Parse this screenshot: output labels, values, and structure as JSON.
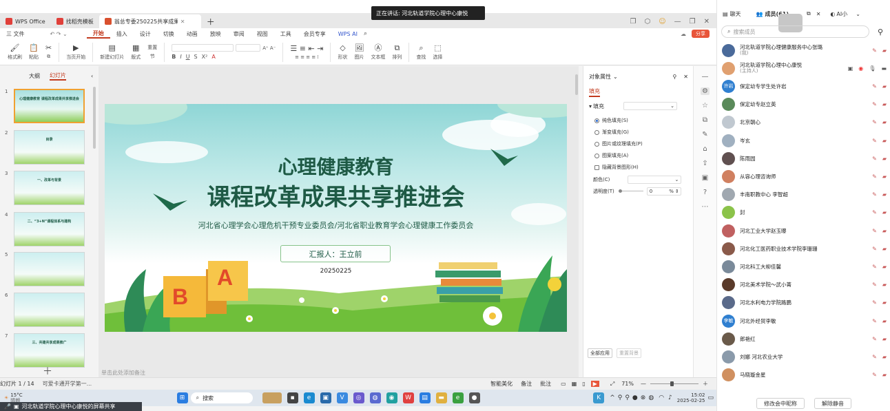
{
  "speaking_banner": "正在讲话: 河北轨道学院心理中心康悦",
  "tabs": [
    {
      "label": "WPS Office",
      "color": "#e0403a"
    },
    {
      "label": "找稻壳模板",
      "color": "#e0403a"
    },
    {
      "label": "翁总专委250225共享成果.pp",
      "color": "#d9502e"
    }
  ],
  "menu": [
    "三 文件",
    "开始",
    "插入",
    "设计",
    "切换",
    "动画",
    "放映",
    "审阅",
    "视图",
    "工具",
    "会员专享",
    "WPS AI"
  ],
  "share_button": "分享",
  "ribbon": {
    "format_painter": "格式刷",
    "paste": "粘贴",
    "from_current": "当页开始",
    "new_slide": "新建幻灯片",
    "layout": "版式",
    "section": "节",
    "reset": "重置",
    "shape": "形状",
    "picture": "图片",
    "textbox": "文本框",
    "arrange": "排列",
    "find": "查找",
    "select": "选择"
  },
  "thumb_tabs": {
    "outline": "大纲",
    "slides": "幻灯片"
  },
  "thumbs": [
    {
      "num": "1",
      "title": "心理健康教育 课程改革成果共享推进会"
    },
    {
      "num": "2",
      "title": "目录"
    },
    {
      "num": "3",
      "title": "一、改革与背景"
    },
    {
      "num": "4",
      "title": "二、“3+N”课程体系与建构"
    },
    {
      "num": "5",
      "title": ""
    },
    {
      "num": "6",
      "title": ""
    },
    {
      "num": "7",
      "title": "三、共建共享成果推广"
    }
  ],
  "slide": {
    "title1": "心理健康教育",
    "title2": "课程改革成果共享推进会",
    "subtitle": "河北省心理学会心理危机干预专业委员会/河北省职业教育学会心理健康工作委员会",
    "reporter": "汇报人：王立前",
    "date": "20250225",
    "letters": [
      "B",
      "A"
    ]
  },
  "notes_placeholder": "单击此处添加备注",
  "props": {
    "title": "对象属性",
    "tab": "填充",
    "fill_label": "填充",
    "options": [
      "纯色填充(S)",
      "渐变填充(G)",
      "图片或纹理填充(P)",
      "图案填充(A)",
      "隐藏背景图形(H)"
    ],
    "color_label": "颜色(C)",
    "transparency_label": "透明度(T)",
    "transparency_value": "0",
    "transparency_unit": "%",
    "transparency_fraction": 0,
    "apply_all": "全部应用",
    "reset_bg": "重置背景"
  },
  "status": {
    "slide_count": "幻灯片 1 / 14",
    "theme": "可爱卡通开学第一...",
    "smart_beautify": "智能美化",
    "notes": "备注",
    "comments": "批注",
    "zoom": "71%",
    "zoom_fraction": 0.44
  },
  "taskbar": {
    "weather_temp": "15°C",
    "weather_desc": "晴朗",
    "search": "搜索",
    "time": "15:02",
    "date": "2025-02-25"
  },
  "sharebar_text": "河北轨道学院心理中心康悦的屏幕共享",
  "meeting": {
    "tab_chat": "聊天",
    "tab_members": "成员(61)",
    "tab_ai": "AI小",
    "search_placeholder": "搜索成员",
    "members": [
      {
        "name": "河北轨道学院心理健康服务中心张璐",
        "role": "(我)",
        "color": "#4a6a9a",
        "initial": ""
      },
      {
        "name": "河北轨道学院心理中心康悦",
        "role": "(主持人)",
        "color": "#e0a070",
        "initial": ""
      },
      {
        "name": "保定幼专学生处许岩",
        "role": "",
        "color": "#2f7fd0",
        "initial": "许岩"
      },
      {
        "name": "保定幼专赵立英",
        "role": "",
        "color": "#5a8a5a",
        "initial": ""
      },
      {
        "name": "北京朝心",
        "role": "",
        "color": "#c0c8d0",
        "initial": ""
      },
      {
        "name": "岑玄",
        "role": "",
        "color": "#a0b0c0",
        "initial": ""
      },
      {
        "name": "陈雨园",
        "role": "",
        "color": "#605050",
        "initial": ""
      },
      {
        "name": "从容心理咨询师",
        "role": "",
        "color": "#d08060",
        "initial": ""
      },
      {
        "name": "丰南职教中心 李智超",
        "role": "",
        "color": "#a0a8b0",
        "initial": ""
      },
      {
        "name": "封",
        "role": "",
        "color": "#8bc34a",
        "initial": ""
      },
      {
        "name": "河北工业大学赵玉曝",
        "role": "",
        "color": "#c06060",
        "initial": ""
      },
      {
        "name": "河北化工医药职业技术学院李珊珊",
        "role": "",
        "color": "#8a5a4a",
        "initial": ""
      },
      {
        "name": "河北科工大柳佳馨",
        "role": "",
        "color": "#7a8a9a",
        "initial": ""
      },
      {
        "name": "河北美术学院～武小菁",
        "role": "",
        "color": "#5a3a2a",
        "initial": ""
      },
      {
        "name": "河北水利电力学院路鹏",
        "role": "",
        "color": "#5a6a8a",
        "initial": ""
      },
      {
        "name": "河北外经贸李敏",
        "role": "",
        "color": "#2f7fd0",
        "initial": "李敏"
      },
      {
        "name": "郎艳红",
        "role": "",
        "color": "#6a5a4a",
        "initial": ""
      },
      {
        "name": "刘娜 河北农业大学",
        "role": "",
        "color": "#8a9aaa",
        "initial": ""
      },
      {
        "name": "马晓璇金星",
        "role": "",
        "color": "#d09060",
        "initial": ""
      }
    ],
    "btn_rename": "修改会中昵称",
    "btn_unmute": "解除静音"
  }
}
